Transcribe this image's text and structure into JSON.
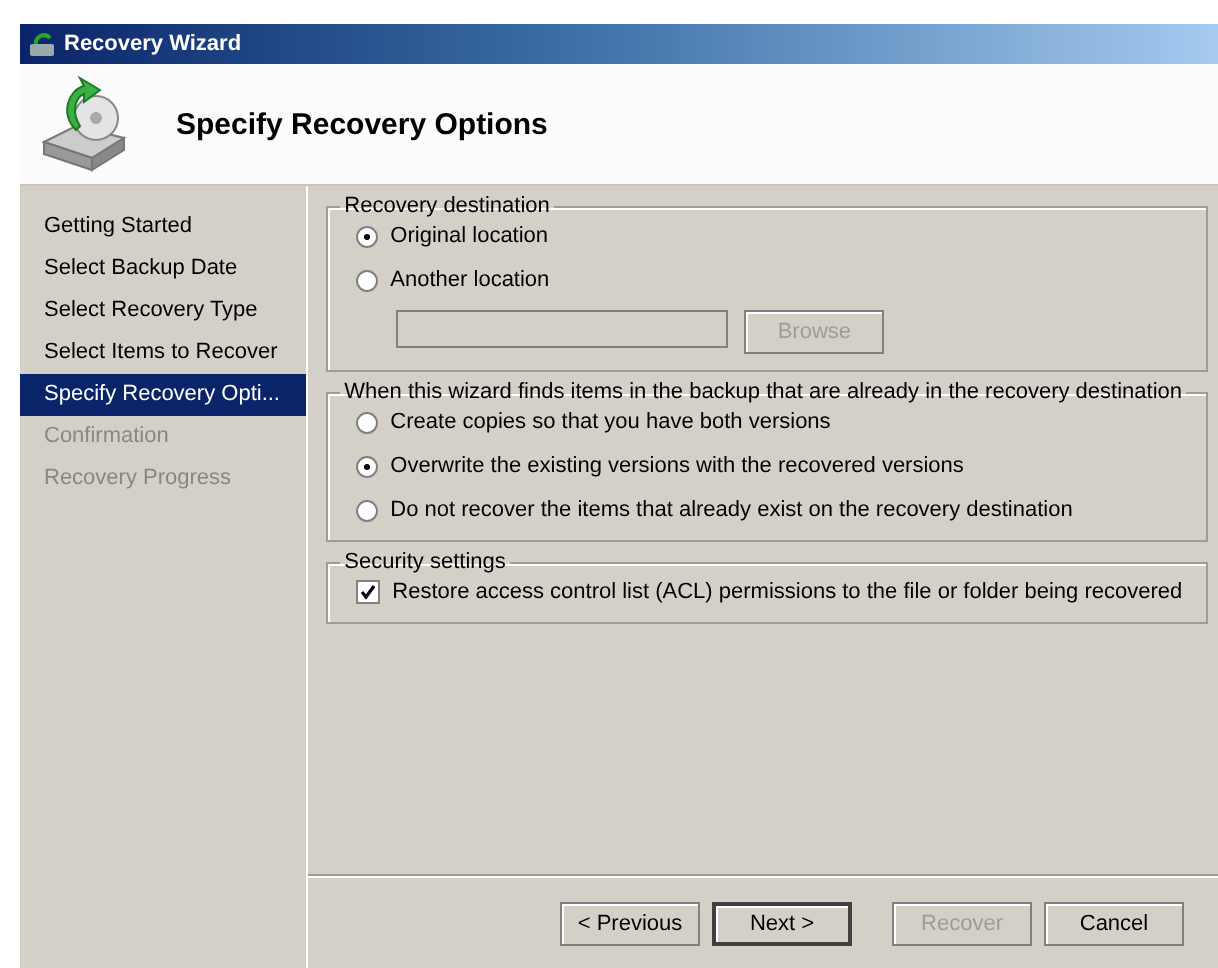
{
  "window": {
    "title": "Recovery Wizard"
  },
  "header": {
    "title": "Specify Recovery Options"
  },
  "steps": [
    {
      "label": "Getting Started",
      "selected": false,
      "disabled": false
    },
    {
      "label": "Select Backup Date",
      "selected": false,
      "disabled": false
    },
    {
      "label": "Select Recovery Type",
      "selected": false,
      "disabled": false
    },
    {
      "label": "Select Items to Recover",
      "selected": false,
      "disabled": false
    },
    {
      "label": "Specify Recovery Opti...",
      "selected": true,
      "disabled": false
    },
    {
      "label": "Confirmation",
      "selected": false,
      "disabled": true
    },
    {
      "label": "Recovery Progress",
      "selected": false,
      "disabled": true
    }
  ],
  "groups": [
    {
      "legend": "Recovery destination",
      "options": [
        {
          "kind": "radio",
          "label": "Original location",
          "selected": true
        },
        {
          "kind": "radio",
          "label": "Another location",
          "selected": false
        },
        {
          "kind": "path",
          "browse": "Browse",
          "disabled": true
        }
      ]
    },
    {
      "legend": "When this wizard finds items in the backup that are already in the recovery destination",
      "options": [
        {
          "kind": "radio",
          "label": "Create copies so that you have both versions",
          "selected": false
        },
        {
          "kind": "radio",
          "label": "Overwrite the existing versions with the recovered versions",
          "selected": true
        },
        {
          "kind": "radio",
          "label": "Do not recover the items that already exist on the recovery destination",
          "selected": false
        }
      ]
    },
    {
      "legend": "Security settings",
      "options": [
        {
          "kind": "checkbox",
          "label": "Restore access control list (ACL) permissions to the file or folder being recovered",
          "checked": true
        }
      ]
    }
  ],
  "buttons": [
    {
      "label": "< Previous",
      "disabled": false,
      "default": false
    },
    {
      "label": "Next >",
      "disabled": false,
      "default": true
    },
    {
      "label": "Recover",
      "disabled": true,
      "default": false
    },
    {
      "label": "Cancel",
      "disabled": false,
      "default": false
    }
  ]
}
